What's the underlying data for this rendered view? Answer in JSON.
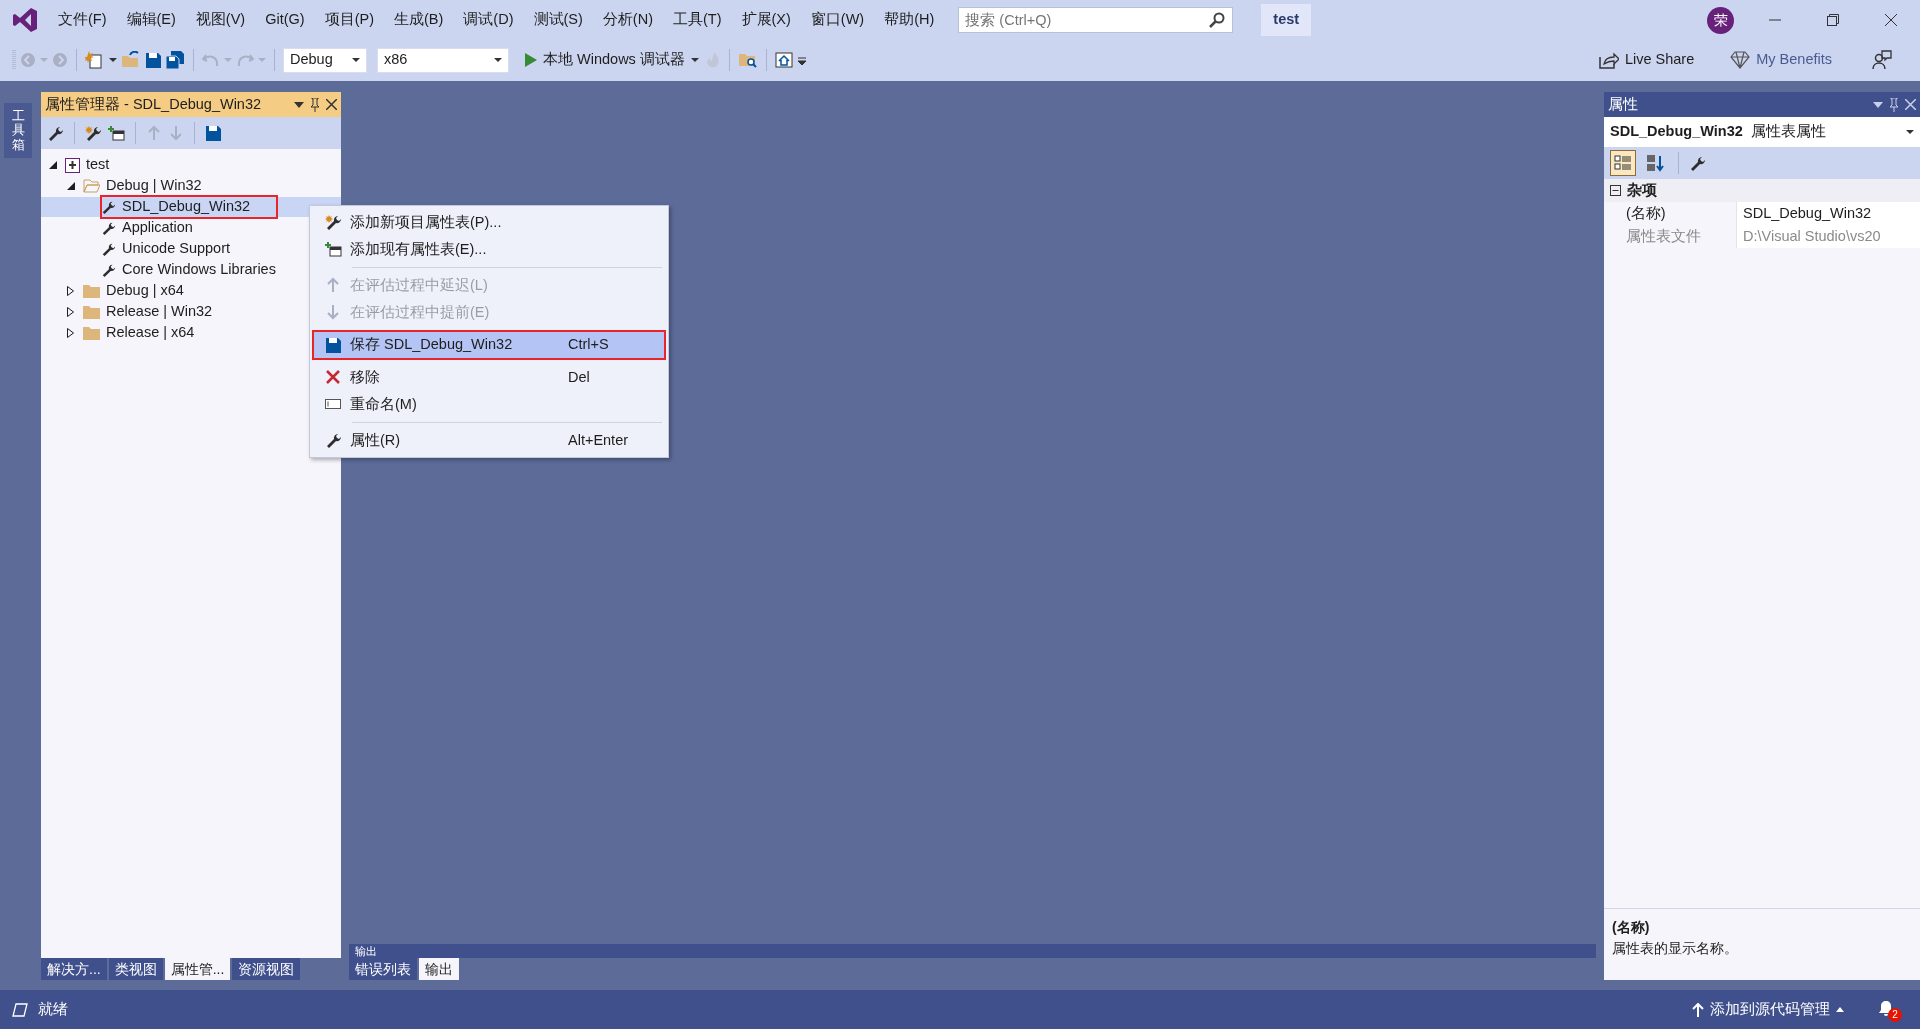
{
  "window": {
    "tag": "test",
    "avatar": "荣",
    "search": {
      "placeholder": "搜索 (Ctrl+Q)"
    }
  },
  "menu": [
    "文件(F)",
    "编辑(E)",
    "视图(V)",
    "Git(G)",
    "项目(P)",
    "生成(B)",
    "调试(D)",
    "测试(S)",
    "分析(N)",
    "工具(T)",
    "扩展(X)",
    "窗口(W)",
    "帮助(H)"
  ],
  "toolbar": {
    "configuration": "Debug",
    "platform": "x86",
    "debugger": "本地 Windows 调试器",
    "live_share": "Live Share",
    "benefits": "My Benefits"
  },
  "side_tab": "工具箱",
  "property_manager": {
    "title": "属性管理器 - SDL_Debug_Win32",
    "tree": [
      {
        "label": "test",
        "kind": "project",
        "expanded": true,
        "selected": false,
        "annotated": false,
        "children": [
          {
            "label": "Debug | Win32",
            "kind": "config",
            "expanded": true,
            "selected": false,
            "annotated": false,
            "children": [
              {
                "label": "SDL_Debug_Win32",
                "kind": "sheet",
                "selected": true,
                "annotated": true
              },
              {
                "label": "Application",
                "kind": "sheet",
                "selected": false,
                "annotated": false
              },
              {
                "label": "Unicode Support",
                "kind": "sheet",
                "selected": false,
                "annotated": false
              },
              {
                "label": "Core Windows Libraries",
                "kind": "sheet",
                "selected": false,
                "annotated": false
              }
            ]
          },
          {
            "label": "Debug | x64",
            "kind": "config",
            "expanded": false,
            "selected": false,
            "annotated": false
          },
          {
            "label": "Release | Win32",
            "kind": "config",
            "expanded": false,
            "selected": false,
            "annotated": false
          },
          {
            "label": "Release | x64",
            "kind": "config",
            "expanded": false,
            "selected": false,
            "annotated": false
          }
        ]
      }
    ],
    "tabs": [
      {
        "label": "解决方...",
        "selected": false
      },
      {
        "label": "类视图",
        "selected": false
      },
      {
        "label": "属性管...",
        "selected": true
      },
      {
        "label": "资源视图",
        "selected": false
      }
    ]
  },
  "output_panel": {
    "title": "输出",
    "tabs": [
      {
        "label": "错误列表",
        "selected": false
      },
      {
        "label": "输出",
        "selected": true
      }
    ]
  },
  "context_menu": [
    {
      "kind": "item",
      "label": "添加新项目属性表(P)...",
      "disabled": false,
      "selected": false,
      "annotated": false
    },
    {
      "kind": "item",
      "label": "添加现有属性表(E)...",
      "disabled": false,
      "selected": false,
      "annotated": false
    },
    {
      "kind": "separator"
    },
    {
      "kind": "item",
      "label": "在评估过程中延迟(L)",
      "disabled": true,
      "selected": false,
      "annotated": false
    },
    {
      "kind": "item",
      "label": "在评估过程中提前(E)",
      "disabled": true,
      "selected": false,
      "annotated": false
    },
    {
      "kind": "item",
      "label": "保存 SDL_Debug_Win32",
      "shortcut": "Ctrl+S",
      "disabled": false,
      "selected": true,
      "annotated": true
    },
    {
      "kind": "item",
      "label": "移除",
      "shortcut": "Del",
      "disabled": false,
      "selected": false,
      "annotated": false
    },
    {
      "kind": "item",
      "label": "重命名(M)",
      "disabled": false,
      "selected": false,
      "annotated": false
    },
    {
      "kind": "separator"
    },
    {
      "kind": "item",
      "label": "属性(R)",
      "shortcut": "Alt+Enter",
      "disabled": false,
      "selected": false,
      "annotated": false
    }
  ],
  "properties": {
    "title": "属性",
    "object": "SDL_Debug_Win32",
    "object_type": "属性表属性",
    "view_buttons": [
      {
        "selected": true
      },
      {
        "selected": false
      }
    ],
    "category": "杂项",
    "expanded": true,
    "rows": [
      {
        "name": "(名称)",
        "value": "SDL_Debug_Win32",
        "readonly": false
      },
      {
        "name": "属性表文件",
        "value": "D:\\Visual Studio\\vs20",
        "readonly": true
      }
    ],
    "description": {
      "title": "(名称)",
      "text": "属性表的显示名称。"
    }
  },
  "status_bar": {
    "text": "就绪",
    "source_control": "添加到源代码管理",
    "notifications": "2"
  }
}
